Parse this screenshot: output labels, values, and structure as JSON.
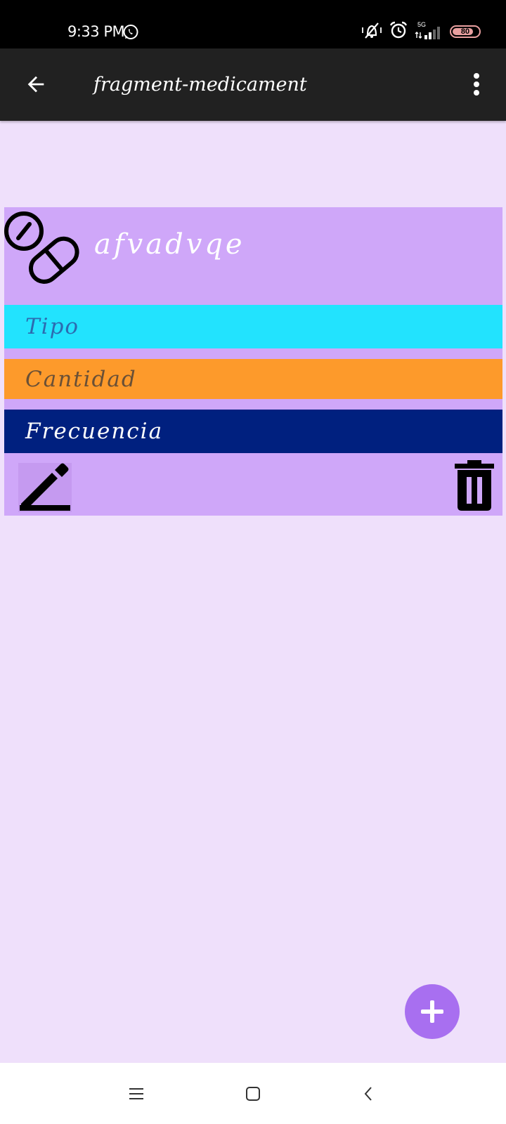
{
  "status_bar": {
    "time": "9:33 PM",
    "network": "5G",
    "battery": "80",
    "battery_level": 0.8,
    "icons": [
      "whatsapp-icon",
      "vibrate-off-icon",
      "alarm-icon",
      "signal-icon",
      "battery-icon"
    ]
  },
  "app_bar": {
    "title": "fragment-medicament",
    "back_icon": "arrow-back-icon",
    "menu_icon": "more-vert-icon"
  },
  "medication_card": {
    "name": "afvadvqe",
    "icon": "pill-icon",
    "fields": {
      "tipo": "Tipo",
      "cantidad": "Cantidad",
      "frecuencia": "Frecuencia"
    },
    "actions": {
      "edit_icon": "edit-pencil-icon",
      "delete_icon": "trash-icon"
    }
  },
  "fab": {
    "icon": "plus-icon"
  },
  "nav_bar": {
    "buttons": [
      "menu-icon",
      "home-square-icon",
      "back-chevron-icon"
    ]
  },
  "colors": {
    "background": "#efe0fb",
    "app_bar": "#212121",
    "card": "#cfa7f9",
    "tipo_row": "#22e3fe",
    "cantidad_row": "#fd9a2b",
    "frecuencia_row": "#00207f",
    "fab": "#a86ff0"
  }
}
